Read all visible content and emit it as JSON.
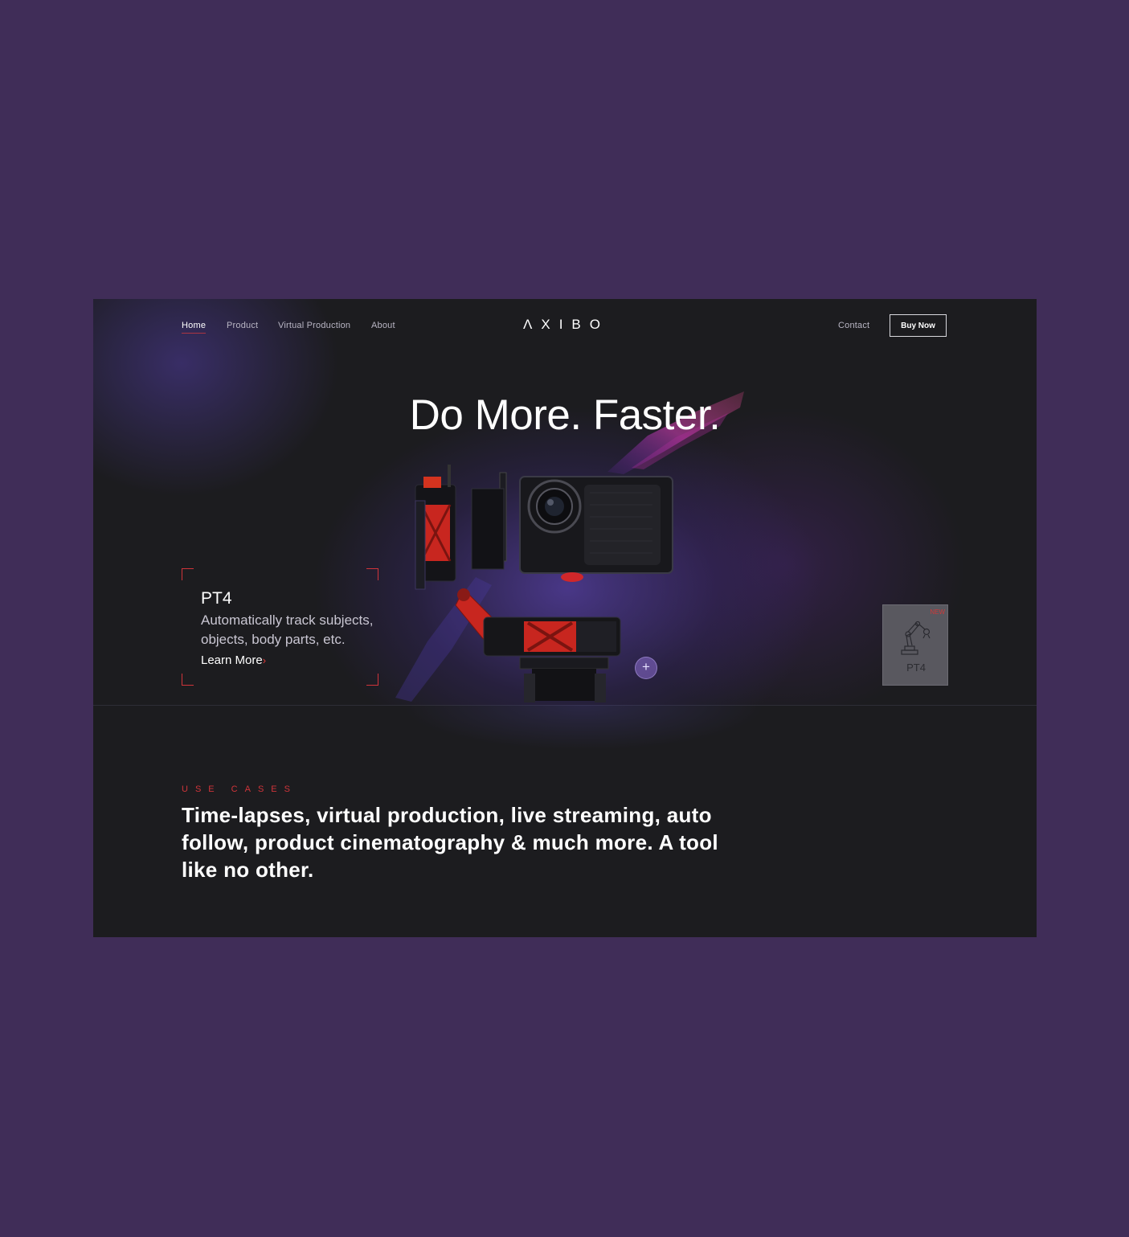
{
  "nav": {
    "items": [
      {
        "label": "Home",
        "active": true
      },
      {
        "label": "Product",
        "active": false
      },
      {
        "label": "Virtual Production",
        "active": false
      },
      {
        "label": "About",
        "active": false
      }
    ],
    "logo": "ΛXIBO",
    "contact": "Contact",
    "buy_now": "Buy Now"
  },
  "hero": {
    "title": "Do More. Faster."
  },
  "feature": {
    "title": "PT4",
    "description": "Automatically track subjects, objects, body parts, etc.",
    "link": "Learn More",
    "link_icon": "chevron-right-icon"
  },
  "card": {
    "badge": "NEW",
    "icon": "robot-arm-icon",
    "label": "PT4"
  },
  "hotspot": {
    "icon": "plus-icon",
    "symbol": "+"
  },
  "use_cases": {
    "eyebrow": "USE CASES",
    "text": "Time-lapses, virtual production, live streaming, auto follow, product cinematography & much more. A tool like no other."
  },
  "colors": {
    "page_background": "#402d58",
    "surface": "#1c1c1f",
    "accent_red": "#d0343a",
    "glow_purple": "#5840aa"
  }
}
